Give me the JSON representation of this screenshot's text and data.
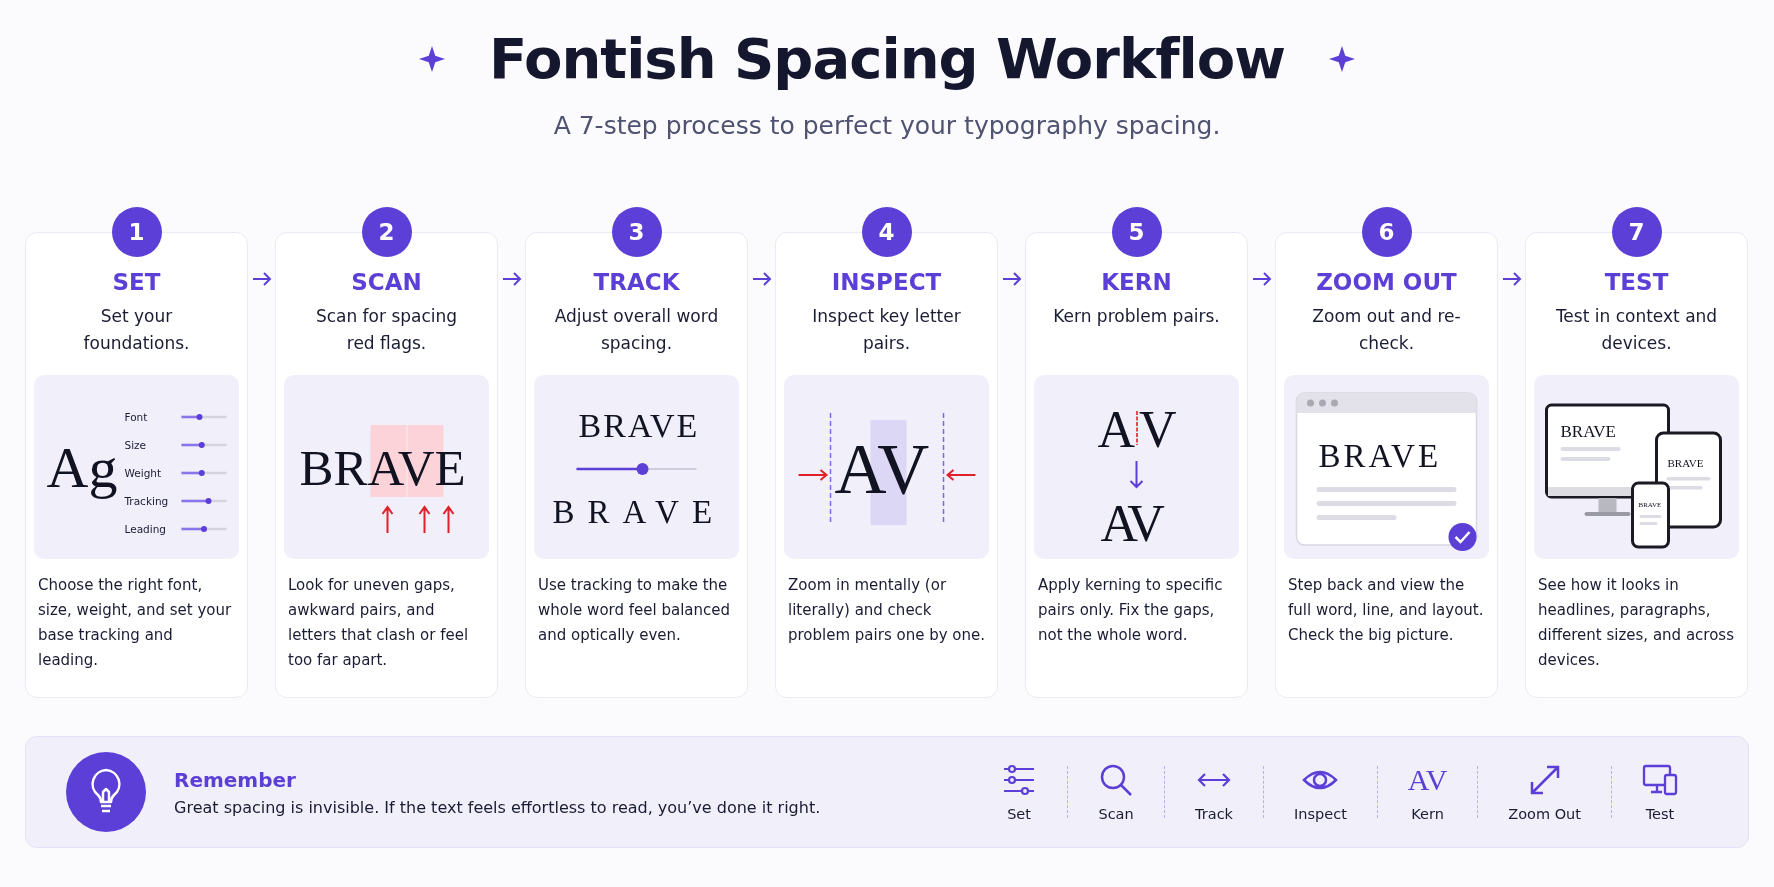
{
  "header": {
    "title": "Fontish Spacing Workflow",
    "subtitle": "A 7-step process to perfect your typography spacing."
  },
  "steps": [
    {
      "number": "1",
      "title": "SET",
      "subtitle": "Set your foundations.",
      "illustration": {
        "kind": "controls",
        "sample": "Ag",
        "sliders": [
          {
            "label": "Font",
            "level": 0.4
          },
          {
            "label": "Size",
            "level": 0.45
          },
          {
            "label": "Weight",
            "level": 0.45
          },
          {
            "label": "Tracking",
            "level": 0.6
          },
          {
            "label": "Leading",
            "level": 0.5
          }
        ]
      },
      "description": "Choose the right font, size, weight, and set your base tracking and leading."
    },
    {
      "number": "2",
      "title": "SCAN",
      "subtitle": "Scan for spacing red flags.",
      "illustration": {
        "kind": "highlight",
        "words": [
          "BRAVE"
        ]
      },
      "description": "Look for uneven gaps, awkward pairs, and letters that clash or feel too far apart."
    },
    {
      "number": "3",
      "title": "TRACK",
      "subtitle": "Adjust overall word spacing.",
      "illustration": {
        "kind": "track",
        "words": [
          "BRAVE",
          "BRAVE"
        ],
        "level": 0.55
      },
      "description": "Use tracking to make the whole word feel balanced and optically even."
    },
    {
      "number": "4",
      "title": "INSPECT",
      "subtitle": "Inspect key letter pairs.",
      "illustration": {
        "kind": "inspect",
        "words": [
          "AV"
        ]
      },
      "description": "Zoom in mentally (or literally) and check problem pairs one by one."
    },
    {
      "number": "5",
      "title": "KERN",
      "subtitle": "Kern problem pairs.",
      "illustration": {
        "kind": "kern",
        "words": [
          "A",
          "V",
          "AV"
        ]
      },
      "description": "Apply kerning to specific pairs only. Fix the gaps, not the whole word."
    },
    {
      "number": "6",
      "title": "ZOOM OUT",
      "subtitle": "Zoom out and re-check.",
      "illustration": {
        "kind": "browser",
        "words": [
          "BRAVE"
        ]
      },
      "description": "Step back and view the full word, line, and layout. Check the big picture."
    },
    {
      "number": "7",
      "title": "TEST",
      "subtitle": "Test in context and devices.",
      "illustration": {
        "kind": "devices",
        "words": [
          "BRAVE",
          "BRAVE",
          "BRAVE"
        ]
      },
      "description": "See how it looks in headlines, paragraphs, different sizes, and across devices."
    }
  ],
  "tip": {
    "title": "Remember",
    "text": "Great spacing is invisible. If the text feels effortless to read, you’ve done it right."
  },
  "legend": [
    {
      "kind": "sliders",
      "label": "Set"
    },
    {
      "kind": "search",
      "label": "Scan"
    },
    {
      "kind": "arrows",
      "label": "Track"
    },
    {
      "kind": "eye",
      "label": "Inspect"
    },
    {
      "kind": "glyph",
      "glyph": "AV",
      "label": "Kern"
    },
    {
      "kind": "expand",
      "label": "Zoom Out"
    },
    {
      "kind": "devices",
      "label": "Test"
    }
  ]
}
